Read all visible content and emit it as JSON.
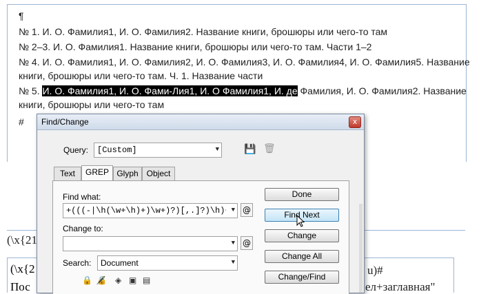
{
  "document": {
    "pilcrow_top": "¶",
    "lines": [
      "№ 1. И. О. Фамилия1, И. О. Фамилия2. Название книги, брошюры или чего-то там",
      "№ 2–3. И. О. Фамилия1. Название книги, брошюры или чего-то там. Части 1–2",
      "№ 4. И. О. Фамилия1, И. О. Фамилия2, И. О. Фамилия3, И. О. Фамилия4, И. О. Фамилия5. Название",
      "книги, брошюры или чего-то там. Ч. 1. Название части",
      "книги, брошюры или чего-то там"
    ],
    "line5_prefix": "№ 5.",
    "line5_selected": "И. О. Фамилия1, И. О. Фами-Лия1, И. О Фамилия1, И. де",
    "line5_rest": "Фамилия, И. О. Фамилия2. Название",
    "pilcrow": "¶",
    "end_mark": "#",
    "lower_frag1": "(\\x{21",
    "lower_frag2": "(\\x{2",
    "lower_frag3": "u)#",
    "lower_frag4": "Пос",
    "lower_frag5": "ел+заглавная\""
  },
  "dialog": {
    "title": "Find/Change",
    "close": "x",
    "query_label": "Query:",
    "query_value": "[Custom]",
    "tabs": [
      "Text",
      "GREP",
      "Glyph",
      "Object"
    ],
    "find_label": "Find what:",
    "find_value": "+(((-|\\h(\\w+\\h)+)\\w+)?)[,.]?)\\h)+(?=\\u)",
    "change_label": "Change to:",
    "change_value": "",
    "search_label": "Search:",
    "search_value": "Document",
    "at_symbol": "@",
    "buttons": {
      "done": "Done",
      "find_next": "Find Next",
      "change": "Change",
      "change_all": "Change All",
      "change_find": "Change/Find"
    }
  }
}
